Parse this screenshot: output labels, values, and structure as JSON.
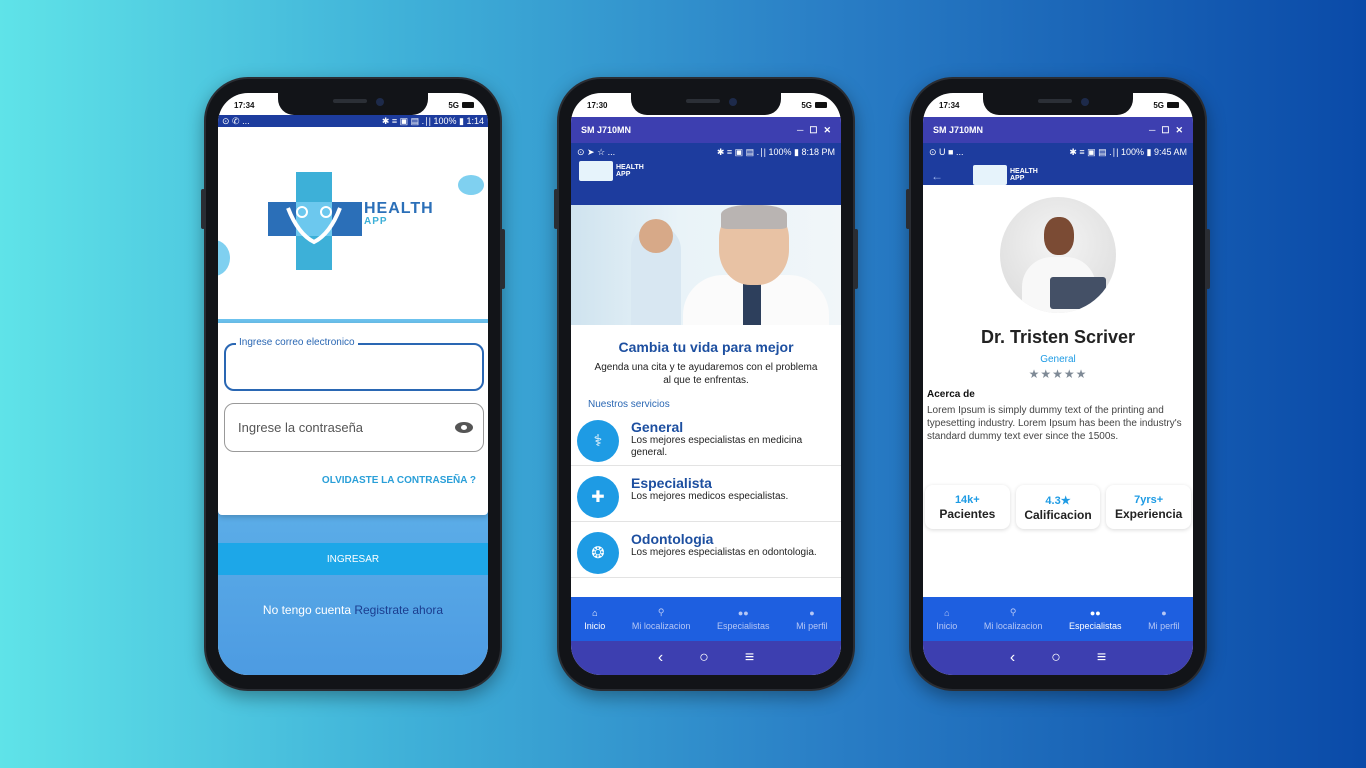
{
  "colors": {
    "brand_blue": "#1d3c9e",
    "accent": "#1e9be4",
    "emulator_bar": "#3d3fb0"
  },
  "phone1": {
    "time": "17:34",
    "signal": "5G",
    "android_status_left": "⊙ ✆ ...",
    "android_status_right": "✱ ≡ ▣ ▤ .∣| 100% ▮ 1:14",
    "logo_title": "HEALTH",
    "logo_sub": "APP",
    "email_label": "Ingrese correo electronico",
    "email_value": "",
    "password_placeholder": "Ingrese la contraseña",
    "forgot": "OLVIDASTE LA CONTRASEÑA ?",
    "login_button": "INGRESAR",
    "no_account": "No tengo cuenta",
    "register": "Registrate ahora"
  },
  "phone2": {
    "time": "17:30",
    "signal": "5G",
    "emulator_title": "SM J710MN",
    "android_status_left": "⊙ ➤ ☆ ...",
    "android_status_right": "✱ ≡ ▣ ▤ .∣| 100% ▮ 8:18 PM",
    "logo_title": "HEALTH",
    "logo_sub": "APP",
    "hero_title": "Cambia tu vida para mejor",
    "hero_sub": "Agenda una cita y te ayudaremos con el problema al que te enfrentas.",
    "services_title": "Nuestros servicios",
    "services": [
      {
        "name": "General",
        "desc": "Los mejores especialistas en medicina general.",
        "icon": "stethoscope-icon",
        "glyph": "⚕"
      },
      {
        "name": "Especialista",
        "desc": "Los mejores medicos especialistas.",
        "icon": "medicine-icon",
        "glyph": "✚"
      },
      {
        "name": "Odontologia",
        "desc": "Los mejores especialistas en odontologia.",
        "icon": "tooth-icon",
        "glyph": "❂"
      }
    ],
    "nav": [
      {
        "label": "Inicio",
        "icon": "home-icon"
      },
      {
        "label": "Mi localizacion",
        "icon": "location-icon"
      },
      {
        "label": "Especialistas",
        "icon": "people-icon"
      },
      {
        "label": "Mi perfil",
        "icon": "person-icon"
      }
    ],
    "active_nav": 0
  },
  "phone3": {
    "time": "17:34",
    "signal": "5G",
    "emulator_title": "SM J710MN",
    "android_status_left": "⊙ U ■ ...",
    "android_status_right": "✱ ≡ ▣ ▤ .∣| 100% ▮ 9:45 AM",
    "logo_title": "HEALTH",
    "logo_sub": "APP",
    "doctor_name": "Dr. Tristen Scriver",
    "specialty": "General",
    "stars": "★★★★★",
    "about_title": "Acerca de",
    "about": "Lorem Ipsum is simply dummy text of the printing and typesetting industry. Lorem Ipsum has been the industry's standard dummy text ever since the 1500s.",
    "stats": [
      {
        "value": "14k+",
        "label": "Pacientes"
      },
      {
        "value": "4.3★",
        "label": "Calificacion"
      },
      {
        "value": "7yrs+",
        "label": "Experiencia"
      }
    ],
    "nav": [
      {
        "label": "Inicio",
        "icon": "home-icon"
      },
      {
        "label": "Mi localizacion",
        "icon": "location-icon"
      },
      {
        "label": "Especialistas",
        "icon": "people-icon"
      },
      {
        "label": "Mi perfil",
        "icon": "person-icon"
      }
    ],
    "active_nav": 2
  }
}
